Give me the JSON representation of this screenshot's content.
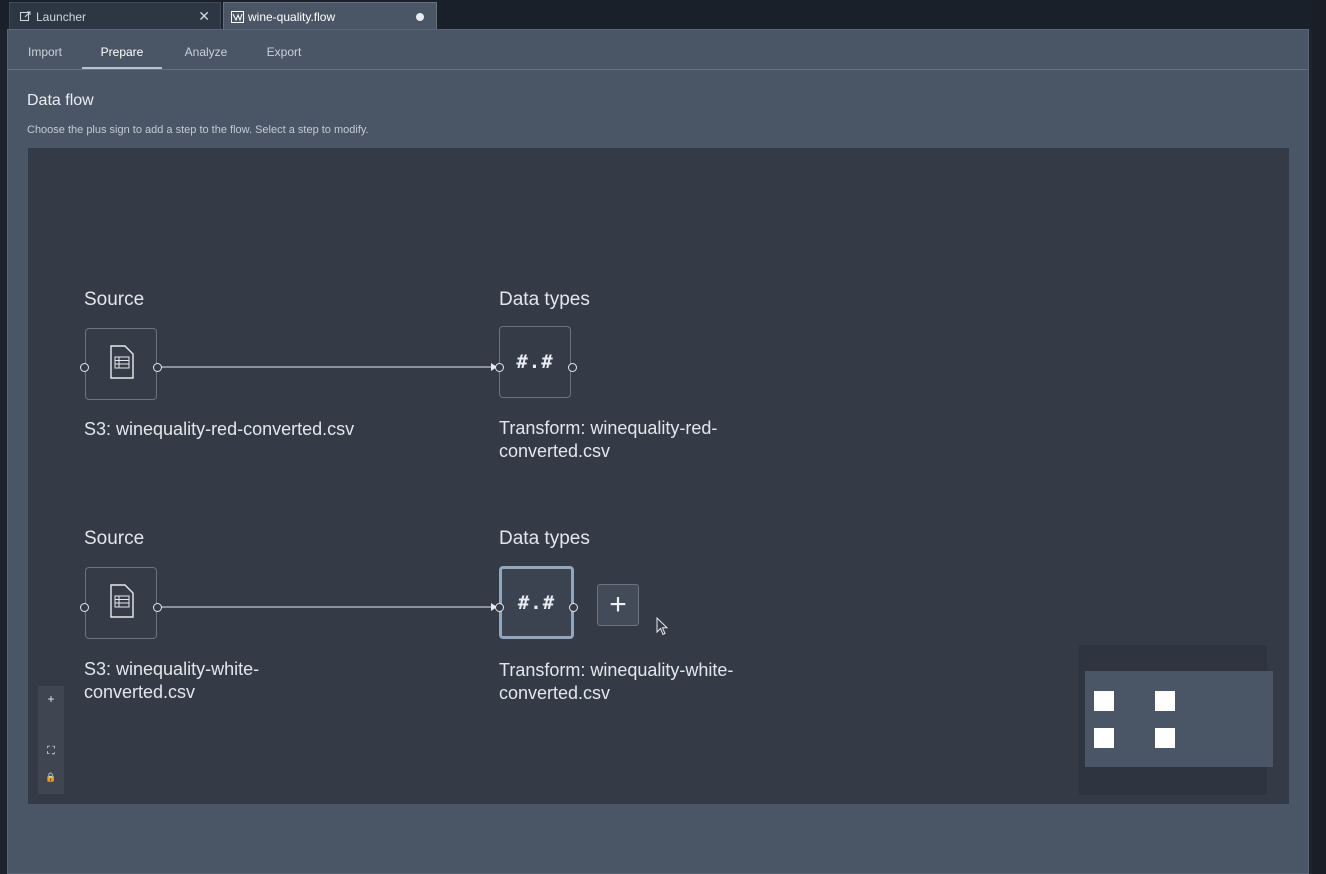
{
  "tabs": [
    {
      "label": "Launcher",
      "icon": "external-link-icon",
      "close": "✕"
    },
    {
      "label": "wine-quality.flow",
      "icon": "flow-icon",
      "unsaved": true
    }
  ],
  "subtabs": [
    "Import",
    "Prepare",
    "Analyze",
    "Export"
  ],
  "active_subtab": "Prepare",
  "page": {
    "title": "Data flow",
    "hint": "Choose the plus sign to add a step to the flow. Select a step to modify."
  },
  "flows": [
    {
      "source": {
        "title": "Source",
        "label": "S3: winequality-red-converted.csv",
        "icon": "csv-file-icon"
      },
      "transform": {
        "title": "Data types",
        "symbol": "#.#",
        "label_line1": "Transform: winequality-red-",
        "label_line2": "converted.csv"
      }
    },
    {
      "source": {
        "title": "Source",
        "label_line1": "S3: winequality-white-",
        "label_line2": "converted.csv",
        "icon": "csv-file-icon"
      },
      "transform": {
        "title": "Data types",
        "symbol": "#.#",
        "label_line1": "Transform: winequality-white-",
        "label_line2": "converted.csv",
        "selected": true
      }
    }
  ],
  "add_step": "+",
  "zoom_controls": {
    "zoom_in": "+",
    "fit": "⛶",
    "lock": "🔒"
  },
  "colors": {
    "canvas": "#343a46",
    "panel": "#4a5666",
    "selected_border": "#93a6bb"
  }
}
